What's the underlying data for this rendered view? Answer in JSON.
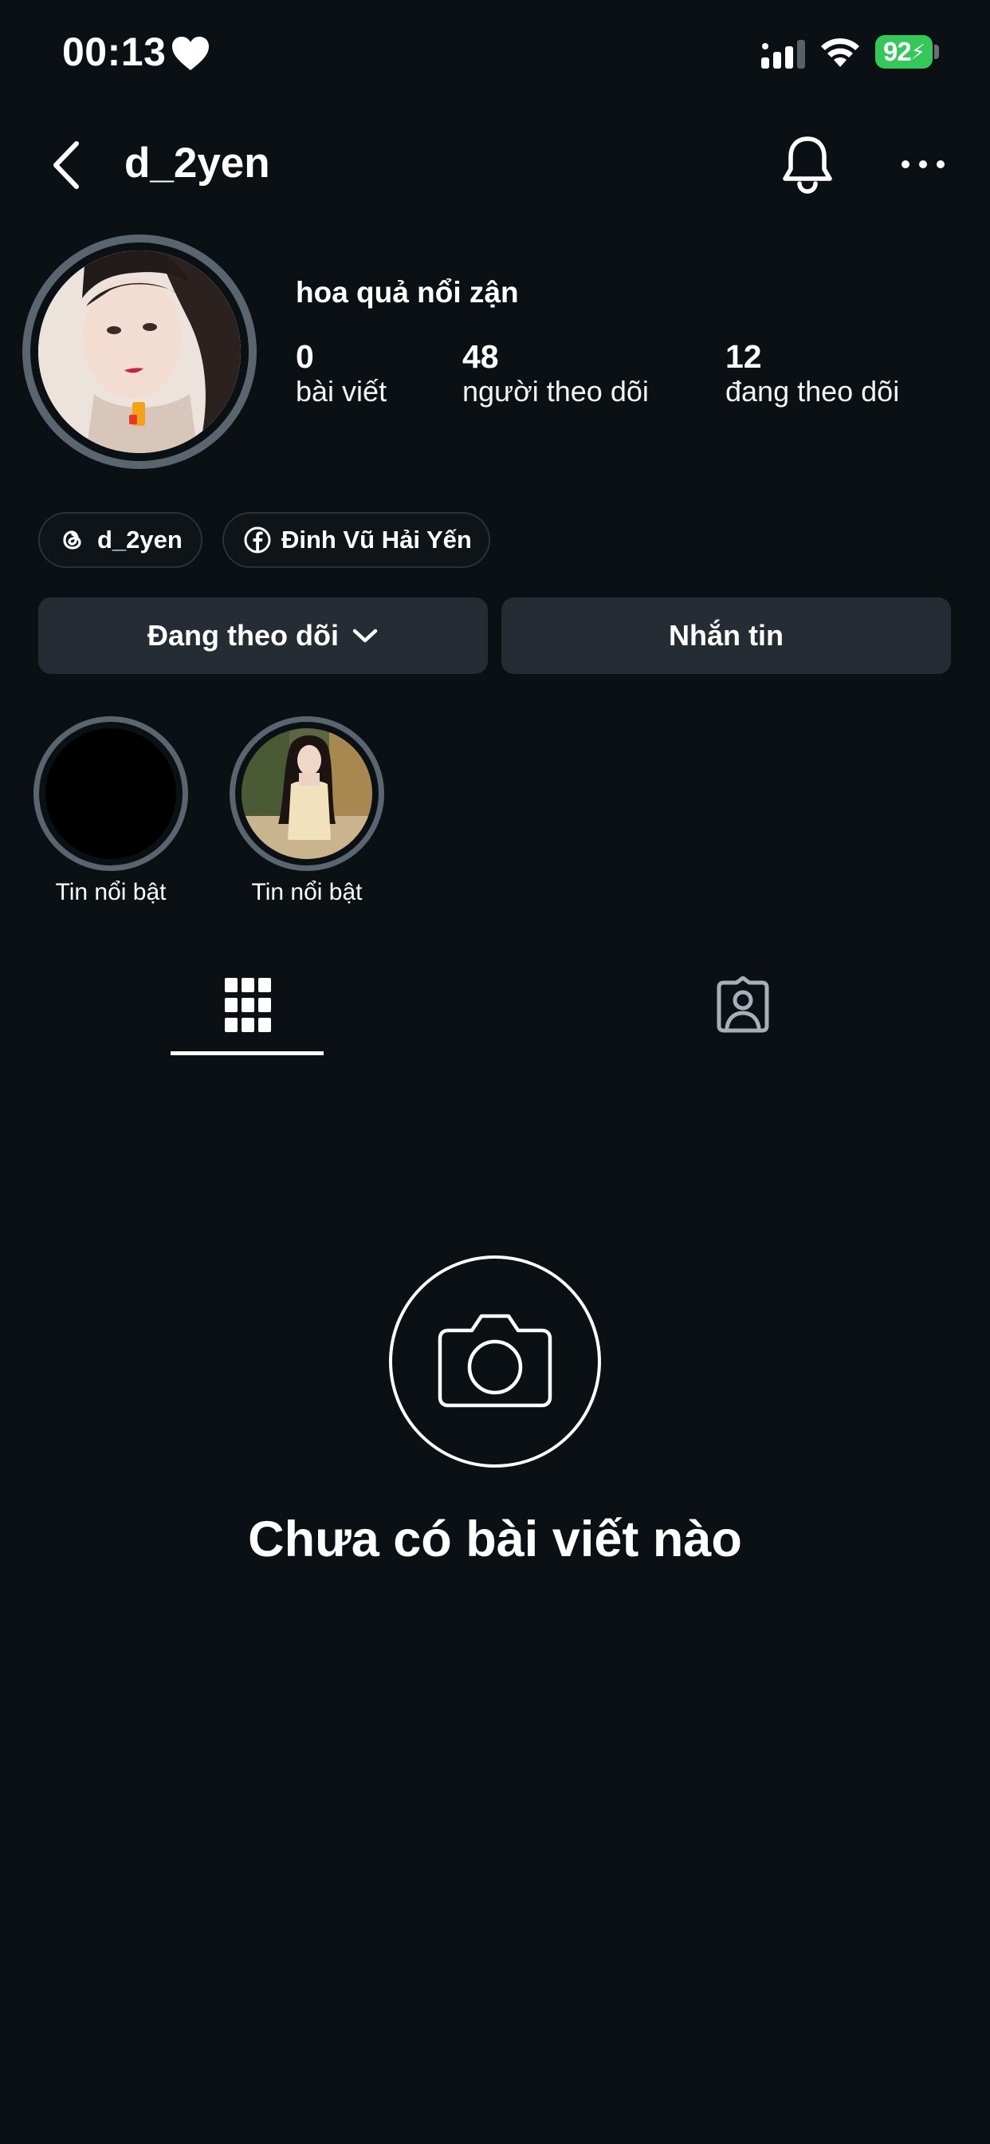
{
  "status_bar": {
    "time": "00:13",
    "battery": "92",
    "icons": [
      "heart-icon",
      "cellular-signal-icon",
      "wifi-icon",
      "battery-icon"
    ],
    "battery_color": "#34c759"
  },
  "header": {
    "username": "d_2yen",
    "icons": [
      "back-chevron-icon",
      "bell-icon",
      "more-dots-icon"
    ]
  },
  "profile": {
    "display_name": "hoa quả nổi zận",
    "stats": [
      {
        "value": "0",
        "label": "bài viết"
      },
      {
        "value": "48",
        "label": "người theo dõi"
      },
      {
        "value": "12",
        "label": "đang theo dõi"
      }
    ]
  },
  "links": {
    "threads": {
      "label": "d_2yen",
      "icon": "threads-icon"
    },
    "facebook": {
      "label": "Đinh Vũ Hải Yến",
      "icon": "facebook-icon"
    }
  },
  "actions": {
    "following_label": "Đang theo dõi",
    "message_label": "Nhắn tin"
  },
  "highlights": [
    {
      "label": "Tin nổi bật"
    },
    {
      "label": "Tin nổi bật"
    }
  ],
  "tabs": {
    "icons": [
      "grid-icon",
      "tagged-person-icon"
    ],
    "active": "grid-icon"
  },
  "empty_state": {
    "title": "Chưa có bài viết nào",
    "icon": "camera-icon"
  },
  "colors": {
    "background": "#0b1014",
    "button": "#262c33",
    "ring": "#5b6570"
  }
}
